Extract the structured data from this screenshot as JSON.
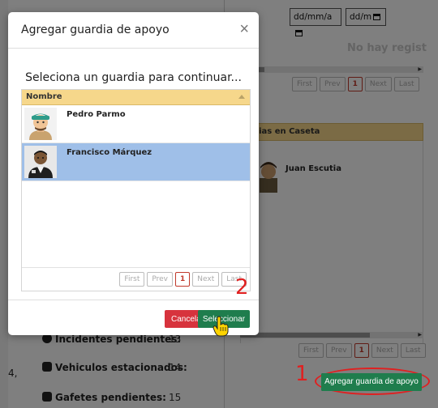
{
  "background": {
    "date_from": "dd/mm/a",
    "date_to": "dd/m",
    "no_records": "No hay regist",
    "top_pager": [
      "First",
      "Prev",
      "1",
      "Next",
      "Last"
    ],
    "caseta_header": "rdias en Caseta",
    "caseta_guard": "Juan Escutia",
    "bottom_pager": [
      "First",
      "Prev",
      "1",
      "Next",
      "Last"
    ],
    "stats": [
      {
        "label": "Incidentes pendientes:",
        "value": "13",
        "icon": "alert-icon"
      },
      {
        "label": "Vehiculos estacionados:",
        "value": "14",
        "icon": "car-icon"
      },
      {
        "label": "Gafetes pendientes:",
        "value": "15",
        "icon": "badge-icon"
      }
    ],
    "left_fragment": "4,",
    "add_support_guard": "Agregar guardia de apoyo"
  },
  "annotations": {
    "step1": "1",
    "step2": "2",
    "color": "#e02020"
  },
  "modal": {
    "title": "Agregar guardia de apoyo",
    "close": "×",
    "subtitle": "Seleciona un guardia para continuar...",
    "grid_header": "Nombre",
    "rows": [
      {
        "name": "Pedro Parmo",
        "selected": false
      },
      {
        "name": "Francisco Márquez",
        "selected": true
      }
    ],
    "pager": [
      "First",
      "Prev",
      "1",
      "Next",
      "Last"
    ],
    "cancel": "Cancelar",
    "select": "Seleccionar"
  },
  "colors": {
    "header_yellow": "#f6d78b",
    "selected_row": "#9fbfe8",
    "green": "#1f7d4d",
    "red": "#d7333d"
  }
}
